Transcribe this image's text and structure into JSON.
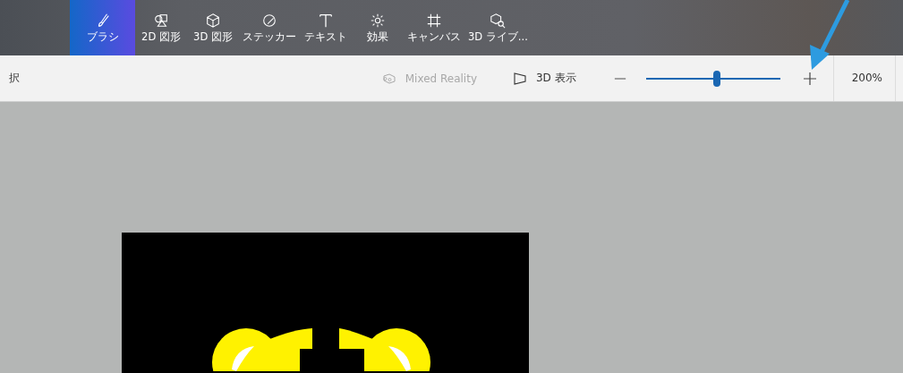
{
  "tools": [
    {
      "label": "ブラシ",
      "selected": true
    },
    {
      "label": "2D 図形",
      "selected": false
    },
    {
      "label": "3D 図形",
      "selected": false
    },
    {
      "label": "ステッカー",
      "selected": false
    },
    {
      "label": "テキスト",
      "selected": false
    },
    {
      "label": "効果",
      "selected": false
    },
    {
      "label": "キャンバス",
      "selected": false
    },
    {
      "label": "3D ライブ...",
      "selected": false
    }
  ],
  "subbar": {
    "left_partial": "択",
    "mixed_reality": {
      "label": "Mixed Reality",
      "disabled": true
    },
    "view_3d": {
      "label": "3D 表示"
    },
    "zoom": {
      "level": 0.53,
      "value": "200%"
    }
  }
}
